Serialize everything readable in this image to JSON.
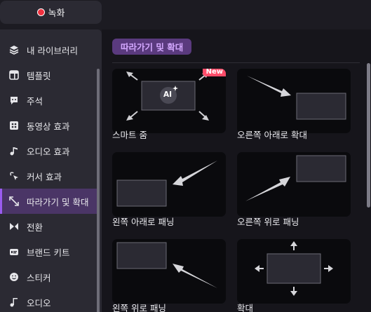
{
  "topbar": {
    "record_label": "녹화",
    "record_color": "#f0313f"
  },
  "sidebar": {
    "items": [
      {
        "label": "내 라이브러리",
        "icon": "layers-icon"
      },
      {
        "label": "템플릿",
        "icon": "template-icon"
      },
      {
        "label": "주석",
        "icon": "annotation-icon"
      },
      {
        "label": "동영상 효과",
        "icon": "video-effect-icon"
      },
      {
        "label": "오디오 효과",
        "icon": "music-note-icon"
      },
      {
        "label": "커서 효과",
        "icon": "cursor-effect-icon"
      },
      {
        "label": "따라가기 및 확대",
        "icon": "zoom-pan-icon",
        "active": true
      },
      {
        "label": "전환",
        "icon": "transition-icon"
      },
      {
        "label": "브랜드 키트",
        "icon": "brand-kit-icon"
      },
      {
        "label": "스티커",
        "icon": "sticker-icon"
      },
      {
        "label": "오디오",
        "icon": "audio-icon"
      }
    ]
  },
  "main": {
    "section_title": "따라가기 및 확대",
    "accent_color": "#9a5cf0",
    "cards": [
      {
        "label": "스마트 줌",
        "badge": "New",
        "ai_label": "AI"
      },
      {
        "label": "오른쪽 아래로 확대"
      },
      {
        "label": "왼쪽 아래로 패닝"
      },
      {
        "label": "오른쪽 위로 패닝"
      },
      {
        "label": "왼쪽 위로 패닝"
      },
      {
        "label": "확대"
      }
    ]
  }
}
